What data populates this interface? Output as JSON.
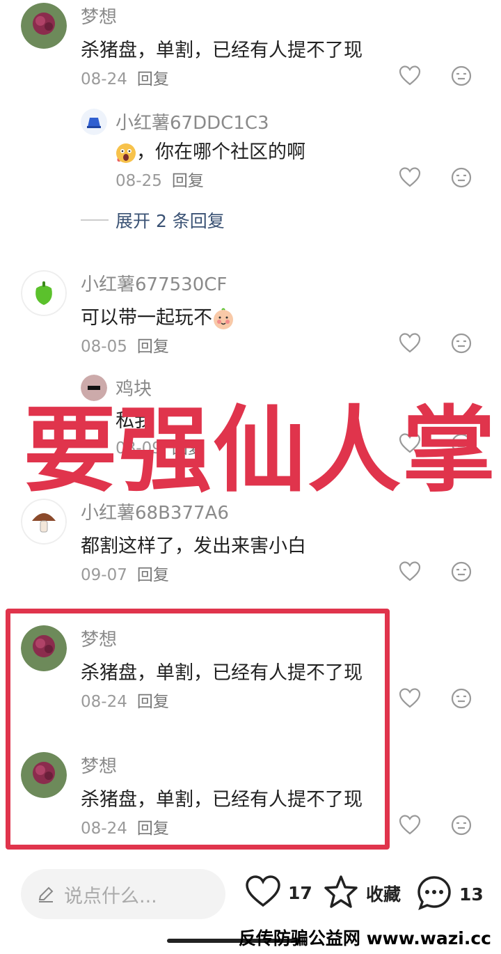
{
  "comments": [
    {
      "name": "梦想",
      "text": "杀猪盘，单割，已经有人提不了现",
      "date": "08-24",
      "reply": "回复"
    },
    {
      "name": "小红薯67DDC1C3",
      "text": "，你在哪个社区的啊",
      "date": "08-25",
      "reply": "回复"
    },
    {
      "name": "小红薯677530CF",
      "text": "可以带一起玩不",
      "date": "08-05",
      "reply": "回复"
    },
    {
      "name": "鸡块",
      "text": "私我",
      "date": "08-09",
      "reply": "回复"
    },
    {
      "name": "小红薯68B377A6",
      "text": "都割这样了，发出来害小白",
      "date": "09-07",
      "reply": "回复"
    },
    {
      "name": "梦想",
      "text": "杀猪盘，单割，已经有人提不了现",
      "date": "08-24",
      "reply": "回复"
    },
    {
      "name": "梦想",
      "text": "杀猪盘，单割，已经有人提不了现",
      "date": "08-24",
      "reply": "回复"
    }
  ],
  "expand_replies": "展开 2 条回复",
  "watermark": "要强仙人掌",
  "bottom_bar": {
    "input_placeholder": "说点什么...",
    "likes": "17",
    "favorite_label": "收藏",
    "comments": "13"
  },
  "footer": "反传防骗公益网 www.wazi.cc",
  "colors": {
    "accent": "#e0344c",
    "link": "#3a5274"
  }
}
